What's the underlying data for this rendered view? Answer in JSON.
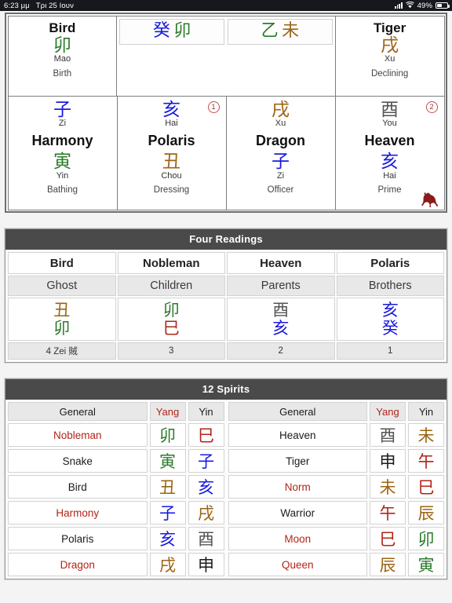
{
  "status_bar": {
    "time": "6:23 μμ",
    "date": "Τρι 25 Ιουν",
    "battery_percent": "49%",
    "signal_icon": "cellular-signal-icon",
    "wifi_icon": "wifi-icon",
    "battery_icon": "battery-icon"
  },
  "top_grid": {
    "row1": [
      {
        "title": "Bird",
        "han": "卯",
        "han_color": "green",
        "roman": "Mao",
        "stage": "Birth"
      },
      {
        "mini": [
          {
            "chars": [
              {
                "t": "癸",
                "c": "blue"
              },
              {
                "t": "卯",
                "c": "green"
              }
            ]
          },
          {
            "chars": [
              {
                "t": "乙",
                "c": "green"
              },
              {
                "t": "未",
                "c": "brown"
              }
            ]
          }
        ]
      },
      {
        "title": "Tiger",
        "han": "戌",
        "han_color": "brown",
        "roman": "Xu",
        "stage": "Declining"
      }
    ],
    "row2": [
      {
        "upper_han": "子",
        "upper_color": "blue",
        "upper_roman": "Zi",
        "title": "Harmony",
        "lower_han": "寅",
        "lower_color": "green",
        "lower_roman": "Yin",
        "stage": "Bathing",
        "badge": "",
        "horse": false
      },
      {
        "upper_han": "亥",
        "upper_color": "blue",
        "upper_roman": "Hai",
        "title": "Polaris",
        "lower_han": "丑",
        "lower_color": "brown",
        "lower_roman": "Chou",
        "stage": "Dressing",
        "badge": "1",
        "horse": false
      },
      {
        "upper_han": "戌",
        "upper_color": "brown",
        "upper_roman": "Xu",
        "title": "Dragon",
        "lower_han": "子",
        "lower_color": "blue",
        "lower_roman": "Zi",
        "stage": "Officer",
        "badge": "",
        "horse": false
      },
      {
        "upper_han": "酉",
        "upper_color": "gray",
        "upper_roman": "You",
        "title": "Heaven",
        "lower_han": "亥",
        "lower_color": "blue",
        "lower_roman": "Hai",
        "stage": "Prime",
        "badge": "2",
        "horse": true
      }
    ]
  },
  "four_readings": {
    "header": "Four Readings",
    "columns": [
      {
        "name": "Bird",
        "relation": "Ghost",
        "glyphs": [
          {
            "t": "丑",
            "c": "brown"
          },
          {
            "t": "卯",
            "c": "green"
          }
        ],
        "note": "4 Zei 賊"
      },
      {
        "name": "Nobleman",
        "relation": "Children",
        "glyphs": [
          {
            "t": "卯",
            "c": "green"
          },
          {
            "t": "巳",
            "c": "red"
          }
        ],
        "note": "3"
      },
      {
        "name": "Heaven",
        "relation": "Parents",
        "glyphs": [
          {
            "t": "酉",
            "c": "gray"
          },
          {
            "t": "亥",
            "c": "blue"
          }
        ],
        "note": "2"
      },
      {
        "name": "Polaris",
        "relation": "Brothers",
        "glyphs": [
          {
            "t": "亥",
            "c": "blue"
          },
          {
            "t": "癸",
            "c": "blue"
          }
        ],
        "note": "1"
      }
    ]
  },
  "twelve_spirits": {
    "header": "12 Spirits",
    "column_labels": {
      "general": "General",
      "yang": "Yang",
      "yin": "Yin"
    },
    "left_rows": [
      {
        "general": "Nobleman",
        "general_color": "red",
        "yang": {
          "t": "卯",
          "c": "green"
        },
        "yin": {
          "t": "巳",
          "c": "red"
        }
      },
      {
        "general": "Snake",
        "general_color": "dark",
        "yang": {
          "t": "寅",
          "c": "green"
        },
        "yin": {
          "t": "子",
          "c": "blue"
        }
      },
      {
        "general": "Bird",
        "general_color": "dark",
        "yang": {
          "t": "丑",
          "c": "brown"
        },
        "yin": {
          "t": "亥",
          "c": "blue"
        }
      },
      {
        "general": "Harmony",
        "general_color": "red",
        "yang": {
          "t": "子",
          "c": "blue"
        },
        "yin": {
          "t": "戌",
          "c": "brown"
        }
      },
      {
        "general": "Polaris",
        "general_color": "dark",
        "yang": {
          "t": "亥",
          "c": "blue"
        },
        "yin": {
          "t": "酉",
          "c": "gray"
        }
      },
      {
        "general": "Dragon",
        "general_color": "red",
        "yang": {
          "t": "戌",
          "c": "brown"
        },
        "yin": {
          "t": "申",
          "c": "dark"
        }
      }
    ],
    "right_rows": [
      {
        "general": "Heaven",
        "general_color": "dark",
        "yang": {
          "t": "酉",
          "c": "gray"
        },
        "yin": {
          "t": "未",
          "c": "brown"
        }
      },
      {
        "general": "Tiger",
        "general_color": "dark",
        "yang": {
          "t": "申",
          "c": "dark"
        },
        "yin": {
          "t": "午",
          "c": "red"
        }
      },
      {
        "general": "Norm",
        "general_color": "red",
        "yang": {
          "t": "未",
          "c": "brown"
        },
        "yin": {
          "t": "巳",
          "c": "red"
        }
      },
      {
        "general": "Warrior",
        "general_color": "dark",
        "yang": {
          "t": "午",
          "c": "red"
        },
        "yin": {
          "t": "辰",
          "c": "brown"
        }
      },
      {
        "general": "Moon",
        "general_color": "red",
        "yang": {
          "t": "巳",
          "c": "red"
        },
        "yin": {
          "t": "卯",
          "c": "green"
        }
      },
      {
        "general": "Queen",
        "general_color": "red",
        "yang": {
          "t": "辰",
          "c": "brown"
        },
        "yin": {
          "t": "寅",
          "c": "green"
        }
      }
    ]
  },
  "colors": {
    "header_bar": "#4a4a4a",
    "accent_red": "#b02418",
    "accent_blue": "#1a1ae0",
    "accent_green": "#2b7a2b",
    "accent_brown": "#9c6514",
    "horse_icon": "#8b1a1a"
  }
}
